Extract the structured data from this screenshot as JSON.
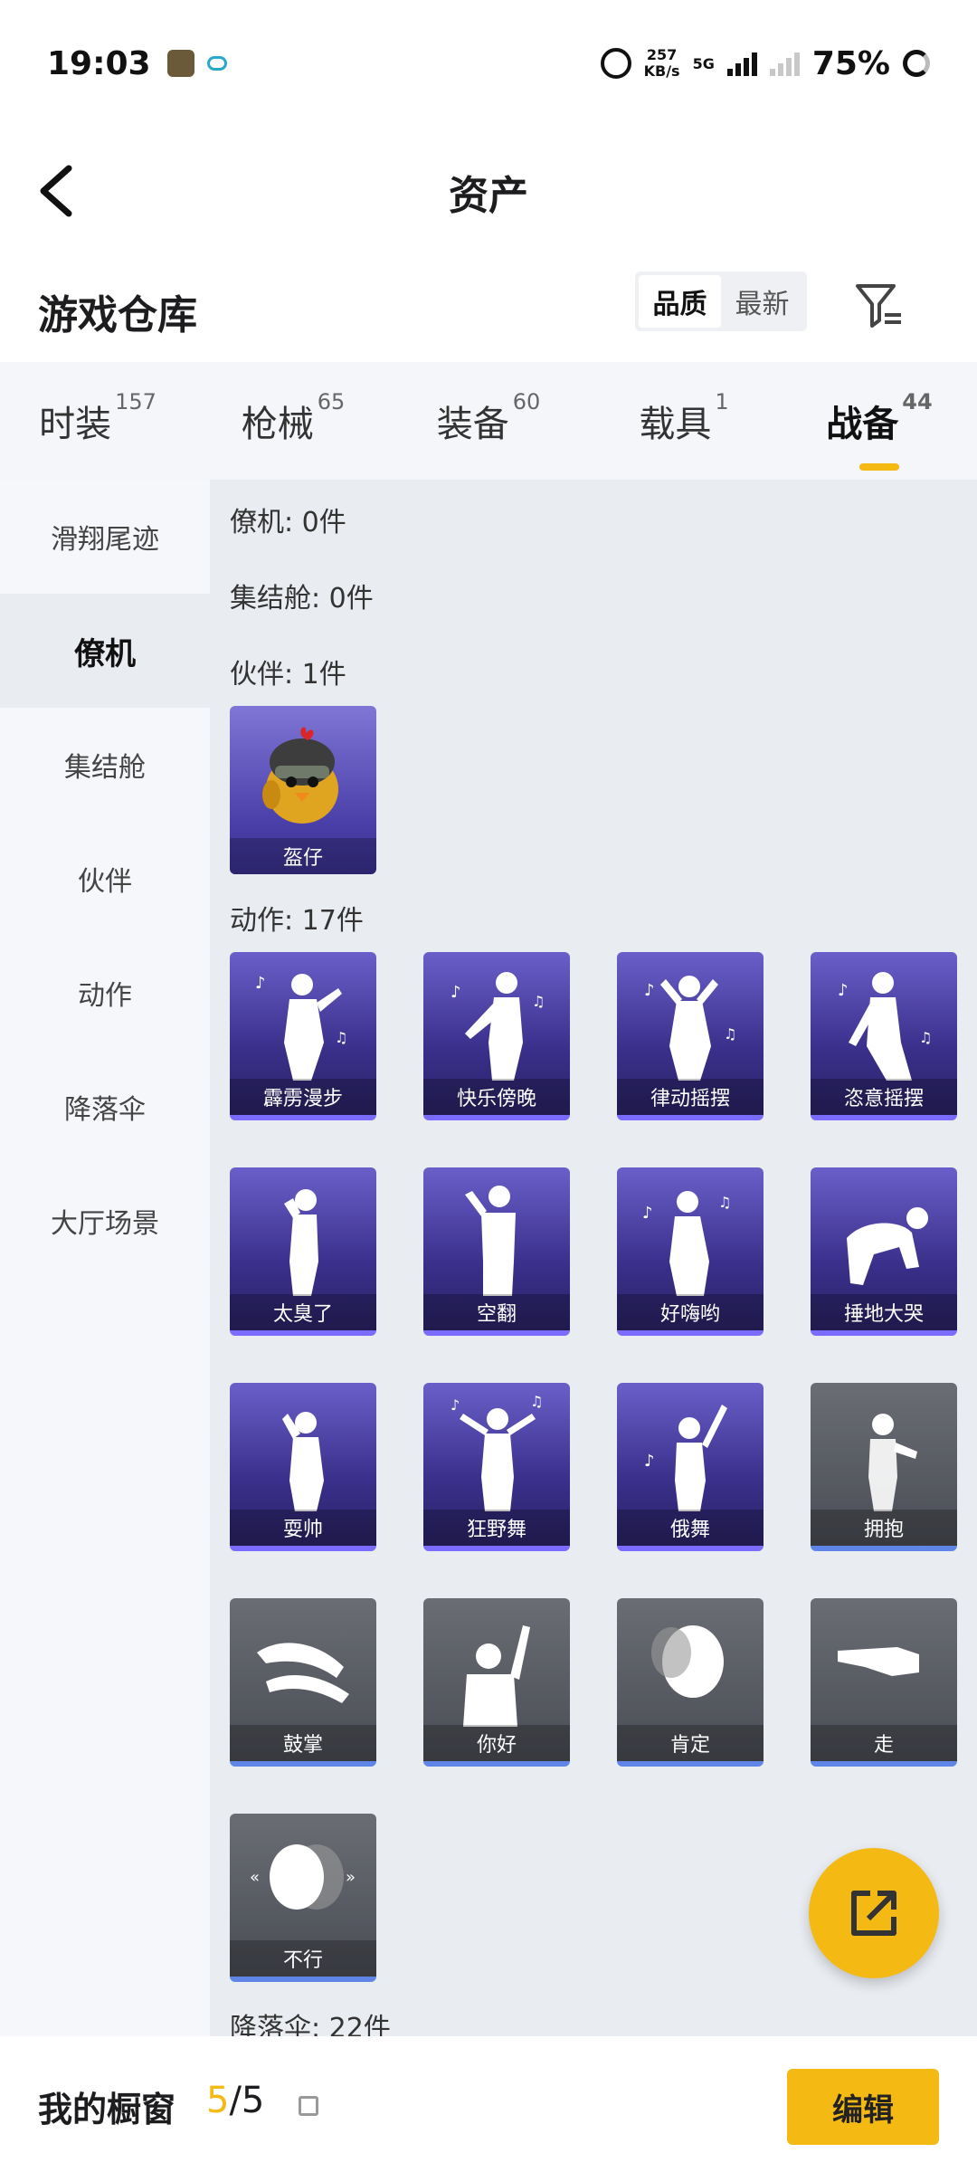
{
  "status": {
    "time": "19:03",
    "speed_value": "257",
    "speed_unit": "KB/s",
    "network": "5G",
    "battery": "75%"
  },
  "header": {
    "title": "资产"
  },
  "section": {
    "title": "游戏仓库",
    "sort_options": [
      "品质",
      "最新"
    ]
  },
  "tabs": [
    {
      "label": "时装",
      "count": "157"
    },
    {
      "label": "枪械",
      "count": "65"
    },
    {
      "label": "装备",
      "count": "60"
    },
    {
      "label": "载具",
      "count": "1"
    },
    {
      "label": "战备",
      "count": "44"
    }
  ],
  "sidebar": [
    "滑翔尾迹",
    "僚机",
    "集结舱",
    "伙伴",
    "动作",
    "降落伞",
    "大厅场景"
  ],
  "content": {
    "sections": [
      "僚机: 0件",
      "集结舱: 0件",
      "伙伴: 1件",
      "动作: 17件",
      "降落伞: 22件"
    ],
    "partner_items": [
      "盔仔"
    ],
    "action_items": [
      "霹雳漫步",
      "快乐傍晚",
      "律动摇摆",
      "恣意摇摆",
      "太臭了",
      "空翻",
      "好嗨哟",
      "捶地大哭",
      "耍帅",
      "狂野舞",
      "俄舞",
      "拥抱",
      "鼓掌",
      "你好",
      "肯定",
      "走",
      "不行"
    ]
  },
  "bottom": {
    "label": "我的橱窗",
    "count_current": "5",
    "count_total": "/5",
    "edit": "编辑"
  },
  "colors": {
    "accent": "#f5b914",
    "purple_card": "#3a2f8a",
    "gray_card": "#4a4d55"
  }
}
